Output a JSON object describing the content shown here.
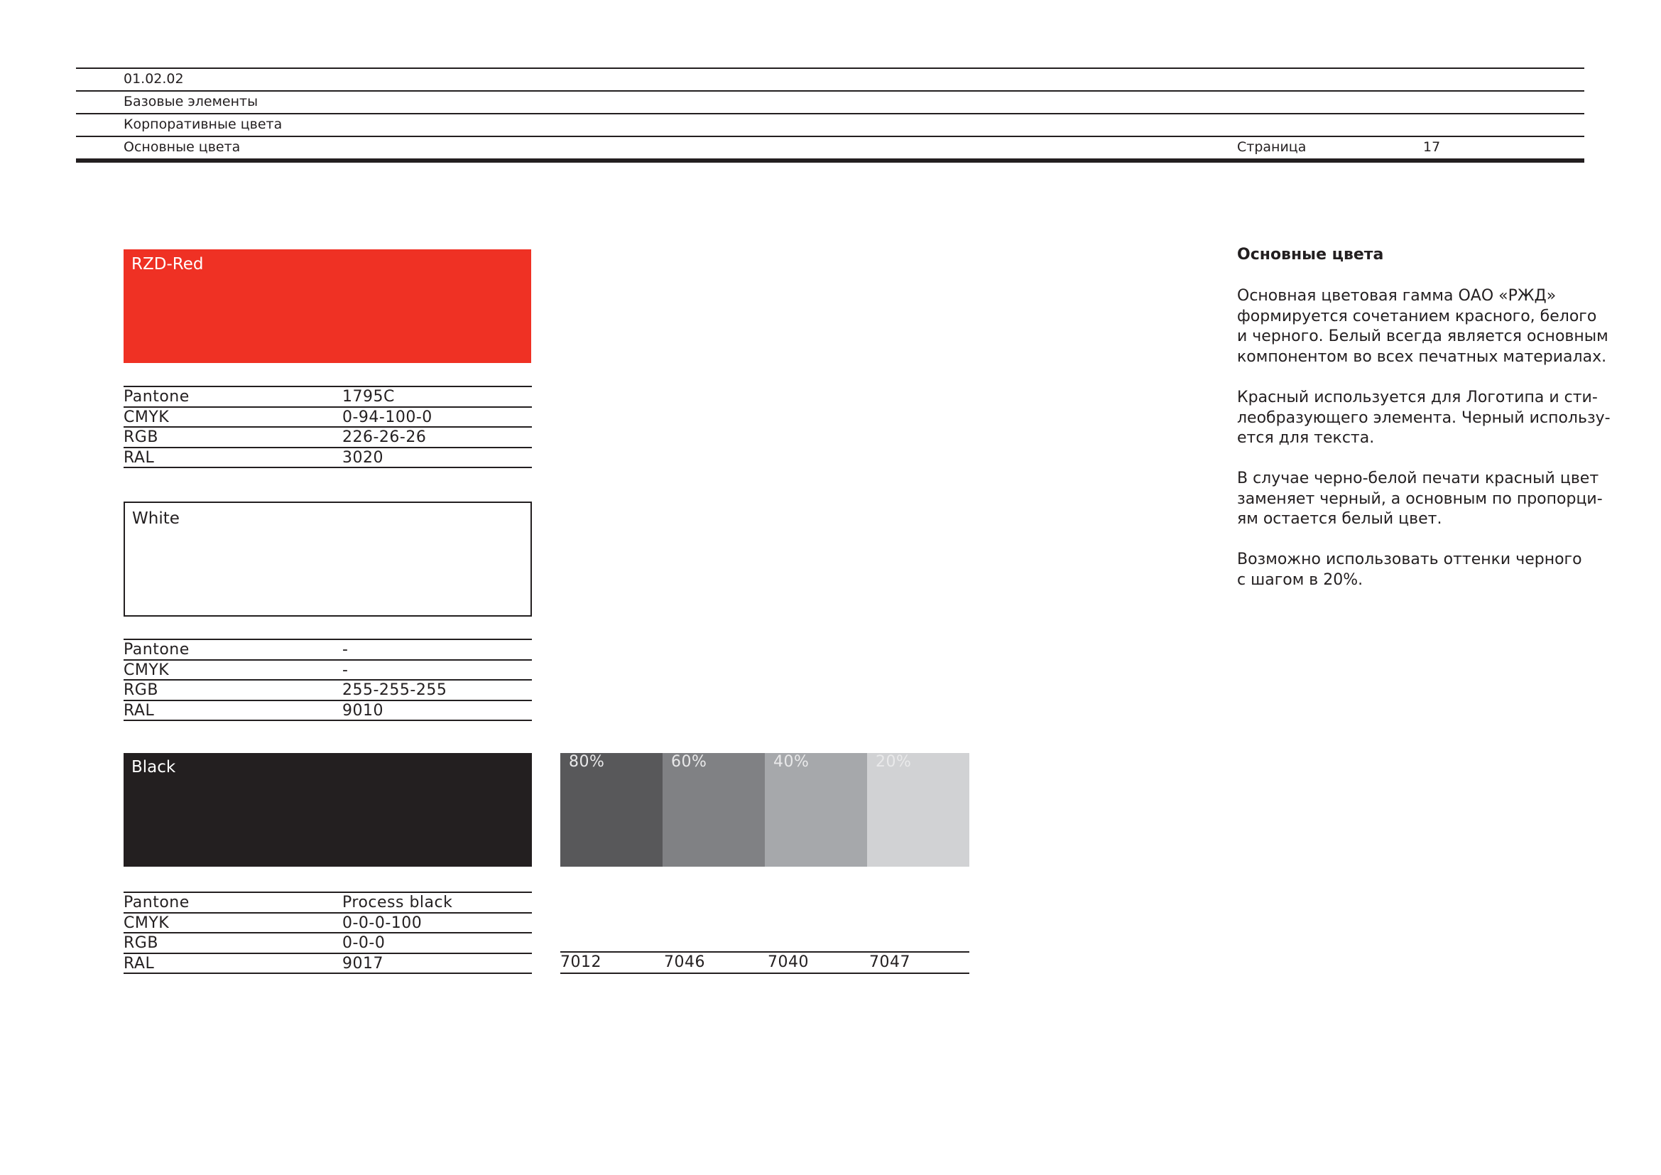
{
  "header": {
    "section_code": "01.02.02",
    "crumb_1": "Базовые элементы",
    "crumb_2": "Корпоративные цвета",
    "crumb_3": "Основные цвета",
    "page_label": "Страница",
    "page_number": "17"
  },
  "colors": {
    "red": {
      "name": "RZD-Red",
      "hex": "#ef3124",
      "specs": [
        {
          "key": "Pantone",
          "value": "1795C"
        },
        {
          "key": "CMYK",
          "value": "0-94-100-0"
        },
        {
          "key": "RGB",
          "value": "226-26-26"
        },
        {
          "key": "RAL",
          "value": "3020"
        }
      ]
    },
    "white": {
      "name": "White",
      "hex": "#ffffff",
      "specs": [
        {
          "key": "Pantone",
          "value": "-"
        },
        {
          "key": "CMYK",
          "value": "-"
        },
        {
          "key": "RGB",
          "value": "255-255-255"
        },
        {
          "key": "RAL",
          "value": "9010"
        }
      ]
    },
    "black": {
      "name": "Black",
      "hex": "#231f20",
      "specs": [
        {
          "key": "Pantone",
          "value": "Process black"
        },
        {
          "key": "CMYK",
          "value": "0-0-0-100"
        },
        {
          "key": "RGB",
          "value": "0-0-0"
        },
        {
          "key": "RAL",
          "value": "9017"
        }
      ]
    }
  },
  "tints": [
    {
      "label": "80%",
      "ral": "7012",
      "hex": "#58585a"
    },
    {
      "label": "60%",
      "ral": "7046",
      "hex": "#808184"
    },
    {
      "label": "40%",
      "ral": "7040",
      "hex": "#a6a8ab"
    },
    {
      "label": "20%",
      "ral": "7047",
      "hex": "#d1d2d4"
    }
  ],
  "description": {
    "title": "Основные цвета",
    "p1": [
      "Основная цветовая гамма ОАО «РЖД»",
      "формируется сочетанием красного, белого",
      "и черного. Белый всегда является основным",
      "компонентом во всех печатных материалах."
    ],
    "p2": [
      "Красный используется для Логотипа и сти-",
      "леобразующего элемента. Черный использу-",
      "ется для текста."
    ],
    "p3": [
      "В случае черно-белой печати красный цвет",
      "заменяет черный, а основным по пропорци-",
      "ям остается белый цвет."
    ],
    "p4": [
      "Возможно использовать оттенки черного",
      "с шагом в 20%."
    ]
  }
}
